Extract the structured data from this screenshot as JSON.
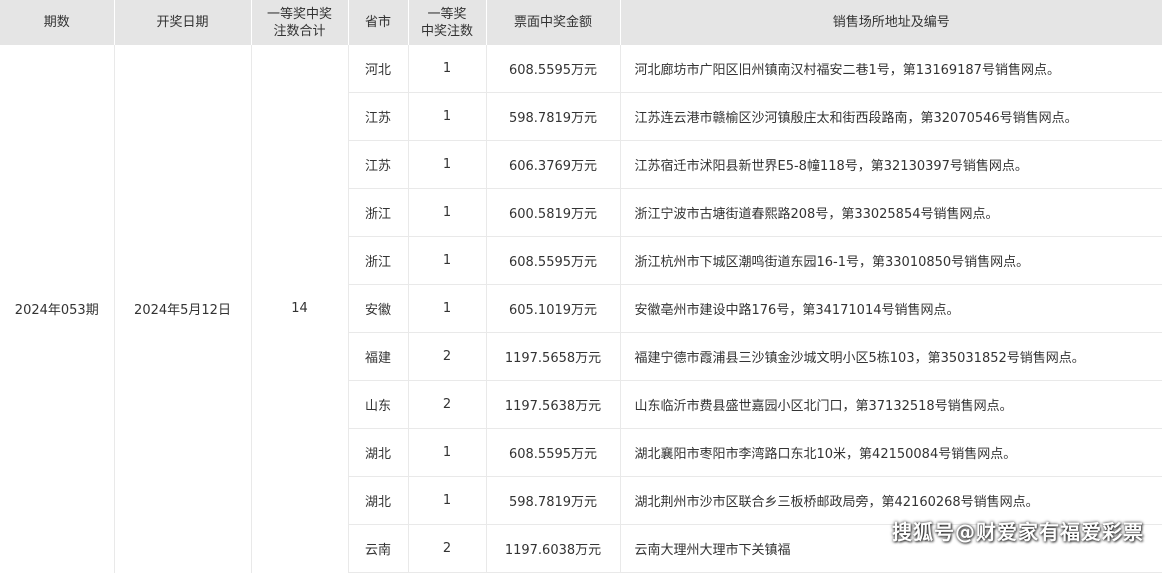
{
  "headers": {
    "issue": "期数",
    "date": "开奖日期",
    "total": [
      "一等奖中奖",
      "注数合计"
    ],
    "province": "省市",
    "count": [
      "一等奖",
      "中奖注数"
    ],
    "amount": "票面中奖金额",
    "address": "销售场所地址及编号"
  },
  "summary": {
    "issue": "2024年053期",
    "date": "2024年5月12日",
    "total": "14"
  },
  "rows": [
    {
      "province": "河北",
      "count": "1",
      "amount": "608.5595万元",
      "address": "河北廊坊市广阳区旧州镇南汉村福安二巷1号，第13169187号销售网点。"
    },
    {
      "province": "江苏",
      "count": "1",
      "amount": "598.7819万元",
      "address": "江苏连云港市赣榆区沙河镇殷庄太和街西段路南，第32070546号销售网点。"
    },
    {
      "province": "江苏",
      "count": "1",
      "amount": "606.3769万元",
      "address": "江苏宿迁市沭阳县新世界E5-8幢118号，第32130397号销售网点。"
    },
    {
      "province": "浙江",
      "count": "1",
      "amount": "600.5819万元",
      "address": "浙江宁波市古塘街道春熙路208号，第33025854号销售网点。"
    },
    {
      "province": "浙江",
      "count": "1",
      "amount": "608.5595万元",
      "address": "浙江杭州市下城区潮鸣街道东园16-1号，第33010850号销售网点。"
    },
    {
      "province": "安徽",
      "count": "1",
      "amount": "605.1019万元",
      "address": "安徽亳州市建设中路176号，第34171014号销售网点。"
    },
    {
      "province": "福建",
      "count": "2",
      "amount": "1197.5658万元",
      "address": "福建宁德市霞浦县三沙镇金沙城文明小区5栋103，第35031852号销售网点。"
    },
    {
      "province": "山东",
      "count": "2",
      "amount": "1197.5638万元",
      "address": "山东临沂市费县盛世嘉园小区北门口，第37132518号销售网点。"
    },
    {
      "province": "湖北",
      "count": "1",
      "amount": "608.5595万元",
      "address": "湖北襄阳市枣阳市李湾路口东北10米，第42150084号销售网点。"
    },
    {
      "province": "湖北",
      "count": "1",
      "amount": "598.7819万元",
      "address": "湖北荆州市沙市区联合乡三板桥邮政局旁，第42160268号销售网点。"
    },
    {
      "province": "云南",
      "count": "2",
      "amount": "1197.6038万元",
      "address": "云南大理州大理市下关镇福"
    }
  ],
  "watermark": "搜狐号@财爱家有福爱彩票"
}
